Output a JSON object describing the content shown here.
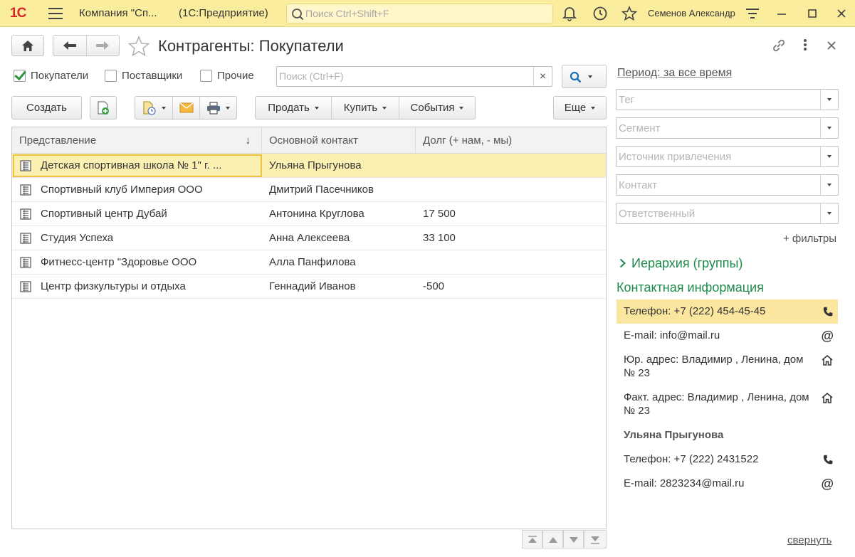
{
  "topbar": {
    "logo": "1С",
    "app_title": "Компания \"Сп...",
    "app_sub": "(1С:Предприятие)",
    "search_placeholder": "Поиск Ctrl+Shift+F",
    "user": "Семенов Александр"
  },
  "header": {
    "title": "Контрагенты: Покупатели"
  },
  "filters": {
    "buyers": "Покупатели",
    "suppliers": "Поставщики",
    "others": "Прочие",
    "search_placeholder": "Поиск (Ctrl+F)",
    "clear": "×"
  },
  "toolbar": {
    "create": "Создать",
    "sell": "Продать",
    "buy": "Купить",
    "events": "События",
    "more": "Еще"
  },
  "table": {
    "columns": [
      "Представление",
      "Основной контакт",
      "Долг (+ нам, - мы)"
    ],
    "sort_icon": "↓",
    "rows": [
      {
        "name": "Детская спортивная школа  № 1\" г. ...",
        "contact": "Ульяна Прыгунова",
        "debt": ""
      },
      {
        "name": "Спортивный клуб Империя ООО",
        "contact": "Дмитрий Пасечников",
        "debt": ""
      },
      {
        "name": "Спортивный центр Дубай",
        "contact": "Антонина Круглова",
        "debt": "17 500"
      },
      {
        "name": "Студия Успеха",
        "contact": "Анна Алексеева",
        "debt": "33 100"
      },
      {
        "name": "Фитнесс-центр \"Здоровье ООО",
        "contact": "Алла Панфилова",
        "debt": ""
      },
      {
        "name": "Центр физкультуры и отдыха",
        "contact": "Геннадий Иванов",
        "debt": "-500"
      }
    ]
  },
  "right": {
    "period": "Период: за все время",
    "fields": [
      "Тег",
      "Сегмент",
      "Источник привлечения",
      "Контакт",
      "Ответственный"
    ],
    "more_filters": "+ фильтры",
    "hierarchy": "Иерархия (группы)",
    "contact_header": "Контактная информация",
    "phone1": "Телефон: +7 (222) 454-45-45",
    "email1": "E-mail: info@mail.ru",
    "legal_addr": "Юр. адрес: Владимир , Ленина, дом № 23",
    "fact_addr": "Факт. адрес: Владимир , Ленина, дом № 23",
    "person": "Ульяна Прыгунова",
    "phone2": "Телефон: +7 (222) 2431522",
    "email2": "E-mail: 2823234@mail.ru",
    "collapse": "свернуть"
  },
  "colors": {
    "topbar": "#fbed9e",
    "selected_row": "#fcefb2",
    "accent_green": "#1d8a4a",
    "logo_red": "#d6262a"
  }
}
